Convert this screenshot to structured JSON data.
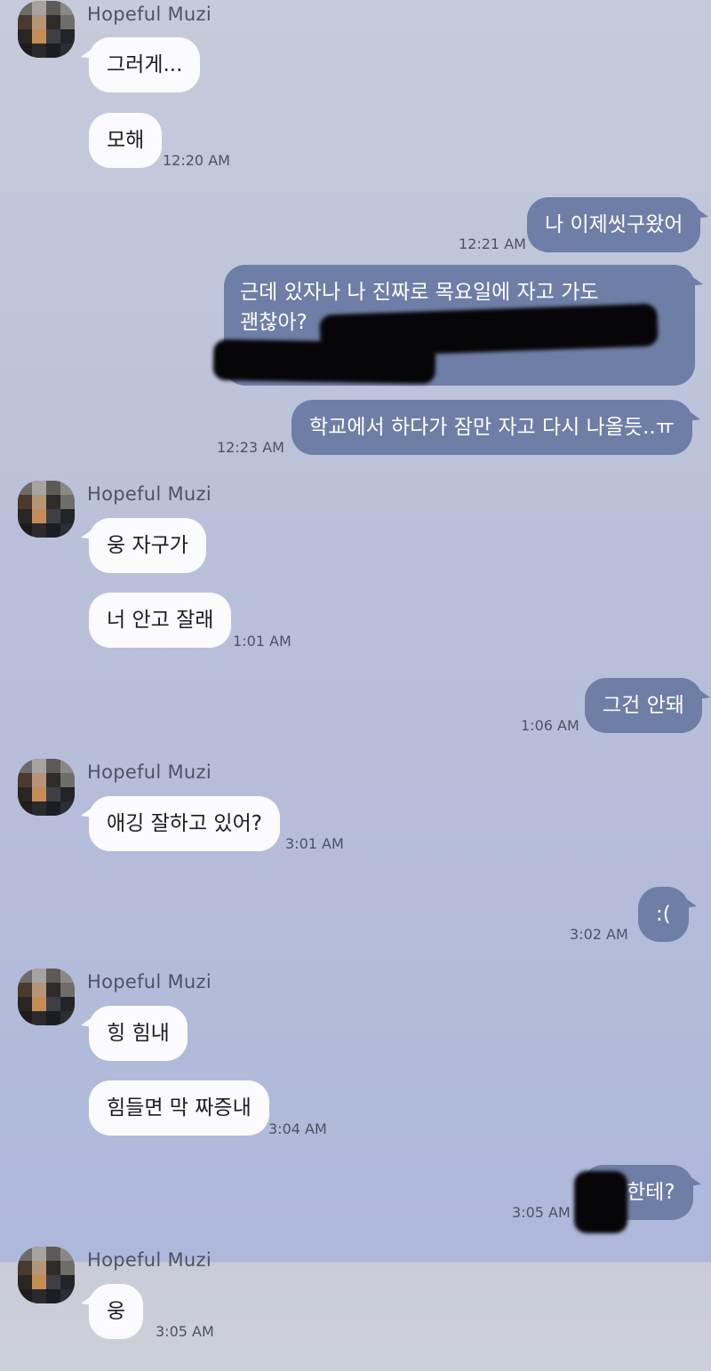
{
  "sender": "Hopeful Muzi",
  "messages": [
    {
      "text": "그러게..."
    },
    {
      "text": "모해",
      "time": "12:20 AM"
    },
    {
      "text": "나 이제씻구왔어",
      "time": "12:21 AM"
    },
    {
      "text_line1": "근데 있자나 나 진짜로 목요일에 자고 가도",
      "text_line2": "괜찮아?"
    },
    {
      "text": "학교에서 하다가 잠만 자고 다시 나올듯..ㅠ",
      "time": "12:23 AM"
    },
    {
      "text": "웅 자구가"
    },
    {
      "text": "너 안고 잘래",
      "time": "1:01 AM"
    },
    {
      "text": "그건 안돼",
      "time": "1:06 AM"
    },
    {
      "text": "애깅 잘하고 있어?",
      "time": "3:01 AM"
    },
    {
      "text": ":(",
      "time": "3:02 AM"
    },
    {
      "text": "힝 힘내"
    },
    {
      "text": "힘들면 막 짜증내",
      "time": "3:04 AM"
    },
    {
      "text": "한테?",
      "time": "3:05 AM"
    },
    {
      "text": "웅",
      "time": "3:05 AM"
    }
  ],
  "colors": {
    "incoming_bubble": "#fbfbfd",
    "outgoing_bubble": "#6f7ea6",
    "background": "#bcc2da"
  }
}
